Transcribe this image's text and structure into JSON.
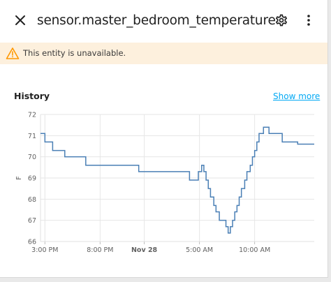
{
  "dialog": {
    "title": "sensor.master_bedroom_temperature",
    "icons": {
      "close": "close-icon",
      "settings": "gear-icon",
      "more": "dots-vertical-icon",
      "alert": "warning-icon"
    }
  },
  "alert": {
    "text": "This entity is unavailable."
  },
  "history": {
    "title": "History",
    "show_more": "Show more"
  },
  "colors": {
    "accent": "#03a9f4",
    "line": "#4a7fb5",
    "alert_bg": "#fdf0dd",
    "alert_icon": "#ff9800"
  },
  "chart_data": {
    "type": "line",
    "ylabel": "F",
    "ylim": [
      66,
      72
    ],
    "y_ticks": [
      "72",
      "71",
      "70",
      "69",
      "68",
      "67",
      "66"
    ],
    "x_ticks": [
      {
        "label": "3:00 PM",
        "x": 15,
        "bold": false
      },
      {
        "label": "8:00 PM",
        "x": 20,
        "bold": false
      },
      {
        "label": "Nov 28",
        "x": 24,
        "bold": true
      },
      {
        "label": "5:00 AM",
        "x": 29,
        "bold": false
      },
      {
        "label": "10:00 AM",
        "x": 34,
        "bold": false
      }
    ],
    "xlim": [
      14.6,
      39.4
    ],
    "x_unit": "hour",
    "series": [
      {
        "x": [
          14.6,
          15.0,
          15.7,
          16.8,
          18.7,
          23.5,
          28.1,
          28.9,
          29.2,
          29.4,
          29.6,
          29.8,
          30.0,
          30.3,
          30.5,
          30.8,
          31.4,
          31.6,
          31.8,
          32.0,
          32.2,
          32.4,
          32.6,
          32.8,
          33.1,
          33.3,
          33.6,
          33.8,
          34.0,
          34.2,
          34.4,
          34.8,
          35.3,
          36.5,
          37.9,
          39.4
        ],
        "y": [
          71.1,
          70.7,
          70.3,
          70.0,
          69.6,
          69.3,
          68.9,
          69.3,
          69.6,
          69.3,
          68.9,
          68.5,
          68.1,
          67.7,
          67.4,
          67.0,
          66.7,
          66.4,
          66.7,
          67.0,
          67.4,
          67.7,
          68.1,
          68.5,
          68.9,
          69.3,
          69.6,
          70.0,
          70.3,
          70.7,
          71.1,
          71.4,
          71.1,
          70.7,
          70.6,
          70.6
        ]
      }
    ]
  }
}
